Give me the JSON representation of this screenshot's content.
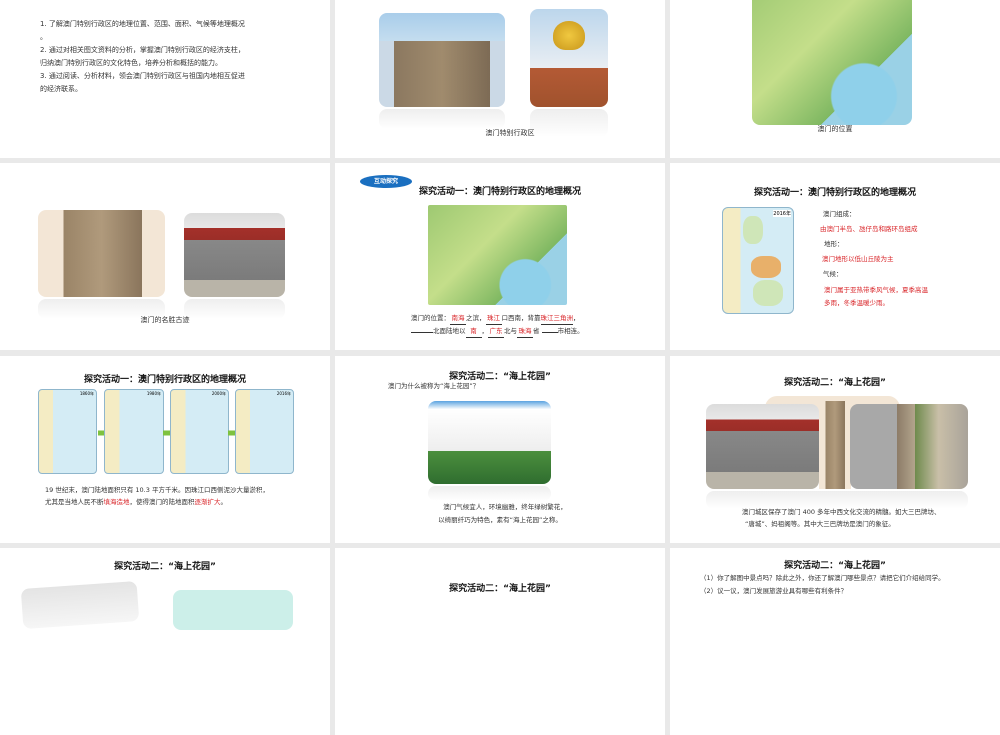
{
  "slides": [
    {
      "objectives": [
        "1. 了解澳门特别行政区的地理位置、范围、面积、气候等地理概况",
        "。",
        "2. 通过对相关图文资料的分析，掌握澳门特别行政区的经济支柱，",
        "归纳澳门特别行政区的文化特色，培养分析和概括的能力。",
        "3. 通过阅读、分析材料，领会澳门特别行政区与祖国内地相互促进",
        "的经济联系。"
      ]
    },
    {
      "caption": "澳门特别行政区"
    },
    {
      "caption": "澳门的位置"
    },
    {
      "caption": "澳门的名胜古迹"
    },
    {
      "badge": "互动探究",
      "title": "探究活动一：澳门特别行政区的地理概况",
      "line1": {
        "a": "澳门的位置：",
        "b1": "南海",
        "c": "之滨，",
        "b2": "珠江",
        "d": "口西南，背靠",
        "b3": "珠江三角洲",
        "e": "，"
      },
      "line2": {
        "a": "北面陆地以",
        "b1": "南",
        "c": "，",
        "b2": "广东",
        "d": "北与",
        "b3": "珠海",
        "e": "省",
        "f": "市相连。"
      }
    },
    {
      "title": "探究活动一：澳门特别行政区的地理概况",
      "map_year": "2016年",
      "composition_label": "澳门组成：",
      "composition": "由澳门半岛、氹仔岛和路环岛组成",
      "terrain_label": "地形：",
      "terrain": "澳门地形以低山丘陵为主",
      "climate_label": "气候：",
      "climate1": "澳门属于亚热带季风气候，夏季高温",
      "climate2": "多雨，冬季温暖少雨。"
    },
    {
      "title": "探究活动一：澳门特别行政区的地理概况",
      "map_years": [
        "1860年",
        "1980年",
        "2000年",
        "2016年"
      ],
      "text1": "19 世纪末，澳门陆地面积只有 10.3 平方千米。因珠江口西侧泥沙大量淤积，",
      "text2a": "尤其是当地人民不断",
      "text2b": "填海造地",
      "text2c": "，使得澳门的陆地面积",
      "text2d": "逐渐扩大",
      "text2e": "。"
    },
    {
      "title": "探究活动二：“海上花园”",
      "question": "澳门为什么被称为“海上花园”？",
      "text1": "澳门气候宜人，环境幽雅，终年绿树繁花，",
      "text2": "以绮丽纤巧为特色，素有“海上花园”之称。"
    },
    {
      "title": "探究活动二：“海上花园”",
      "text1": "澳门城区保存了澳门 400 多年中西文化交流的精髓。如大三巴牌坊、",
      "text2": "“唐城”、妈祖阁等。其中大三巴牌坊是澳门的象征。"
    },
    {
      "title": "探究活动二：“海上花园”"
    },
    {
      "title": "探究活动二：“海上花园”"
    },
    {
      "title": "探究活动二：“海上花园”",
      "q1": "（1）你了解图中景点吗？除此之外，你还了解澳门哪些景点？请把它们介绍给同学。",
      "q2": "（2）议一议，澳门发展旅游业具有哪些有利条件？"
    }
  ]
}
